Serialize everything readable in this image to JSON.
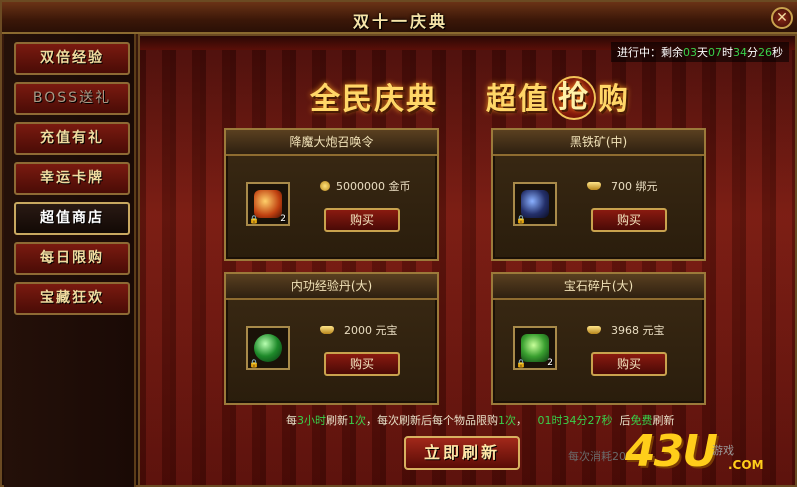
{
  "window": {
    "title": "双十一庆典",
    "close_label": "✕"
  },
  "sidebar": {
    "items": [
      {
        "label": "双倍经验"
      },
      {
        "label": "BOSS送礼"
      },
      {
        "label": "充值有礼"
      },
      {
        "label": "幸运卡牌"
      },
      {
        "label": "超值商店"
      },
      {
        "label": "每日限购"
      },
      {
        "label": "宝藏狂欢"
      }
    ],
    "active_index": 4
  },
  "countdown": {
    "prefix": "进行中：剩余",
    "days": "03",
    "days_unit": "天",
    "hours": "07",
    "hours_unit": "时",
    "minutes": "34",
    "minutes_unit": "分",
    "seconds": "26",
    "seconds_unit": "秒"
  },
  "banner": {
    "left": "全民庆典",
    "right_a": "超值",
    "right_big": "抢",
    "right_b": "购"
  },
  "cards": [
    {
      "title": "降魔大炮召唤令",
      "price": "5000000",
      "currency": "金币",
      "qty": "2",
      "buy_label": "购买",
      "currency_icon": "gold-coin-icon"
    },
    {
      "title": "黑铁矿(中)",
      "price": "700",
      "currency": "绑元",
      "qty": "",
      "buy_label": "购买",
      "currency_icon": "bound-ingot-icon"
    },
    {
      "title": "内功经验丹(大)",
      "price": "2000",
      "currency": "元宝",
      "qty": "",
      "buy_label": "购买",
      "currency_icon": "ingot-icon"
    },
    {
      "title": "宝石碎片(大)",
      "price": "3968",
      "currency": "元宝",
      "qty": "2",
      "buy_label": "购买",
      "currency_icon": "ingot-icon"
    }
  ],
  "notice": {
    "p1": "每",
    "hours": "3小时",
    "p2": "刷新",
    "times": "1次",
    "p3": "，每次刷新后每个物品限购",
    "limit": "1次",
    "p4": "，",
    "timer": "01时34分27秒",
    "p5": "后",
    "free": "免费",
    "p6": "刷新"
  },
  "refresh_button": "立即刷新",
  "cost_note": "每次消耗20",
  "watermark": {
    "logo": "43U",
    "sub": "游戏",
    "domain": ".COM"
  },
  "colors": {
    "accent_gold": "#ffd768",
    "green": "#39d04a",
    "curtain_red": "#7a1a10"
  }
}
